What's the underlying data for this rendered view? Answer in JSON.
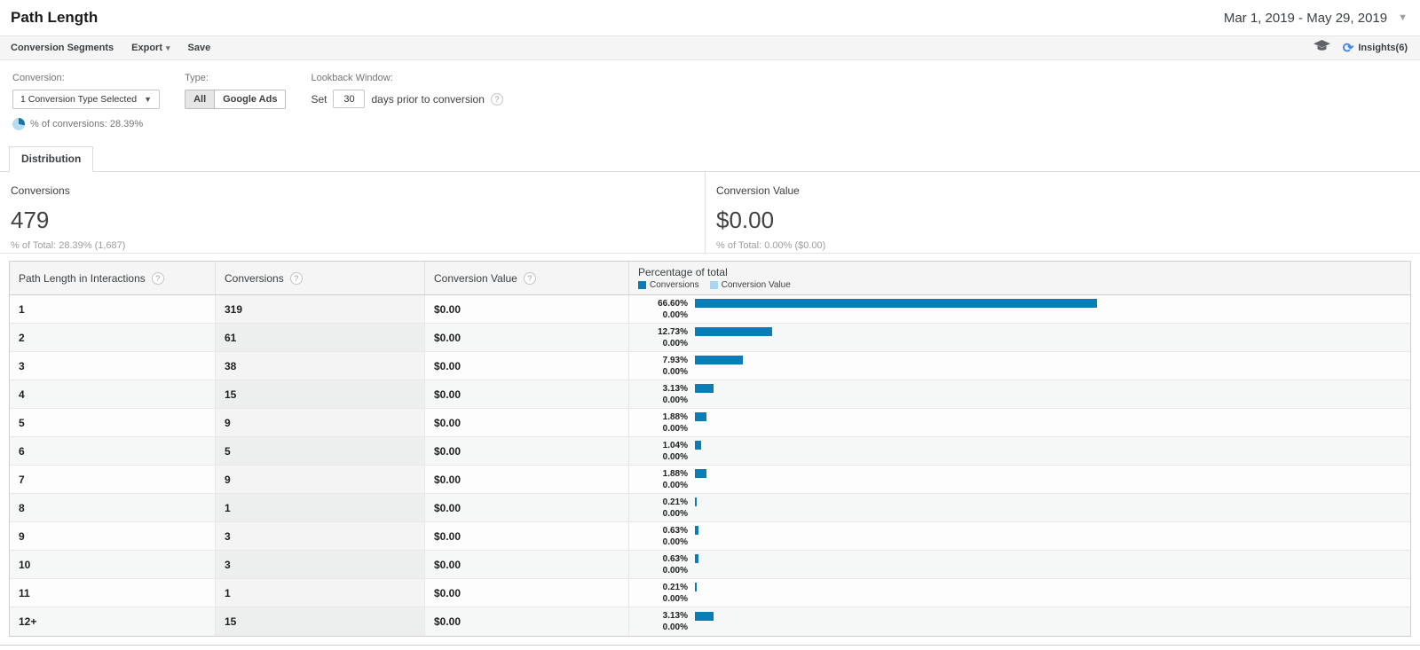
{
  "icons": {
    "help": "?",
    "caret_down": "▾",
    "caret_small": "▼",
    "insights": "⟳"
  },
  "header": {
    "title": "Path Length",
    "date_range": "Mar 1, 2019 - May 29, 2019"
  },
  "toolbar": {
    "segments_label": "Conversion Segments",
    "export_label": "Export",
    "save_label": "Save",
    "insights_label": "Insights(6)"
  },
  "filters": {
    "conversion_label": "Conversion:",
    "conversion_selected": "1 Conversion Type Selected",
    "pct_of_conversions": "% of conversions: 28.39%",
    "type_label": "Type:",
    "type_all": "All",
    "type_google_ads": "Google Ads",
    "lookback_label": "Lookback Window:",
    "set_label": "Set",
    "lookback_days": "30",
    "lookback_suffix": "days prior to conversion"
  },
  "tab": {
    "label": "Distribution"
  },
  "summary": {
    "left_label": "Conversions",
    "left_value": "479",
    "left_subtext": "% of Total: 28.39% (1,687)",
    "right_label": "Conversion Value",
    "right_value": "$0.00",
    "right_subtext": "% of Total: 0.00% ($0.00)"
  },
  "table": {
    "col1": "Path Length in Interactions",
    "col2": "Conversions",
    "col3": "Conversion Value",
    "col4": "Percentage of total",
    "legend_conversions": "Conversions",
    "legend_value": "Conversion Value",
    "colors": {
      "conversions_bar": "#0c7cb9",
      "value_bar": "#a8d6ef"
    },
    "rows": [
      {
        "path": "1",
        "conversions": "319",
        "value": "$0.00",
        "pct_conv": "66.60%",
        "pct_val": "0.00%",
        "pct_conv_num": 66.6,
        "pct_val_num": 0
      },
      {
        "path": "2",
        "conversions": "61",
        "value": "$0.00",
        "pct_conv": "12.73%",
        "pct_val": "0.00%",
        "pct_conv_num": 12.73,
        "pct_val_num": 0
      },
      {
        "path": "3",
        "conversions": "38",
        "value": "$0.00",
        "pct_conv": "7.93%",
        "pct_val": "0.00%",
        "pct_conv_num": 7.93,
        "pct_val_num": 0
      },
      {
        "path": "4",
        "conversions": "15",
        "value": "$0.00",
        "pct_conv": "3.13%",
        "pct_val": "0.00%",
        "pct_conv_num": 3.13,
        "pct_val_num": 0
      },
      {
        "path": "5",
        "conversions": "9",
        "value": "$0.00",
        "pct_conv": "1.88%",
        "pct_val": "0.00%",
        "pct_conv_num": 1.88,
        "pct_val_num": 0
      },
      {
        "path": "6",
        "conversions": "5",
        "value": "$0.00",
        "pct_conv": "1.04%",
        "pct_val": "0.00%",
        "pct_conv_num": 1.04,
        "pct_val_num": 0
      },
      {
        "path": "7",
        "conversions": "9",
        "value": "$0.00",
        "pct_conv": "1.88%",
        "pct_val": "0.00%",
        "pct_conv_num": 1.88,
        "pct_val_num": 0
      },
      {
        "path": "8",
        "conversions": "1",
        "value": "$0.00",
        "pct_conv": "0.21%",
        "pct_val": "0.00%",
        "pct_conv_num": 0.21,
        "pct_val_num": 0
      },
      {
        "path": "9",
        "conversions": "3",
        "value": "$0.00",
        "pct_conv": "0.63%",
        "pct_val": "0.00%",
        "pct_conv_num": 0.63,
        "pct_val_num": 0
      },
      {
        "path": "10",
        "conversions": "3",
        "value": "$0.00",
        "pct_conv": "0.63%",
        "pct_val": "0.00%",
        "pct_conv_num": 0.63,
        "pct_val_num": 0
      },
      {
        "path": "11",
        "conversions": "1",
        "value": "$0.00",
        "pct_conv": "0.21%",
        "pct_val": "0.00%",
        "pct_conv_num": 0.21,
        "pct_val_num": 0
      },
      {
        "path": "12+",
        "conversions": "15",
        "value": "$0.00",
        "pct_conv": "3.13%",
        "pct_val": "0.00%",
        "pct_conv_num": 3.13,
        "pct_val_num": 0
      }
    ]
  },
  "chart_data": {
    "type": "bar",
    "categories": [
      "1",
      "2",
      "3",
      "4",
      "5",
      "6",
      "7",
      "8",
      "9",
      "10",
      "11",
      "12+"
    ],
    "series": [
      {
        "name": "Conversions",
        "values": [
          319,
          61,
          38,
          15,
          9,
          5,
          9,
          1,
          3,
          3,
          1,
          15
        ]
      },
      {
        "name": "Conversion Value",
        "values": [
          0,
          0,
          0,
          0,
          0,
          0,
          0,
          0,
          0,
          0,
          0,
          0
        ]
      },
      {
        "name": "Percentage of total (Conversions)",
        "values": [
          66.6,
          12.73,
          7.93,
          3.13,
          1.88,
          1.04,
          1.88,
          0.21,
          0.63,
          0.63,
          0.21,
          3.13
        ]
      },
      {
        "name": "Percentage of total (Conversion Value)",
        "values": [
          0,
          0,
          0,
          0,
          0,
          0,
          0,
          0,
          0,
          0,
          0,
          0
        ]
      }
    ],
    "title": "Path Length — Percentage of total",
    "xlabel": "Path Length in Interactions",
    "ylabel": "Percentage of total",
    "ylim": [
      0,
      100
    ],
    "legend_position": "top",
    "grid": false
  }
}
